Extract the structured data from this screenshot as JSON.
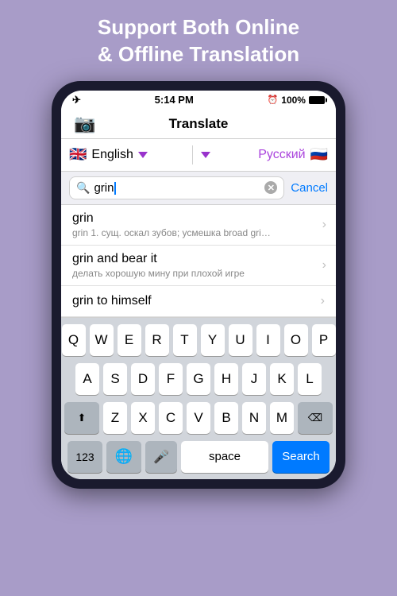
{
  "banner": {
    "line1": "Support Both Online",
    "line2": "& Offline Translation"
  },
  "status_bar": {
    "airplane": "✈",
    "time": "5:14 PM",
    "alarm": "⏰",
    "battery_pct": "100%"
  },
  "nav": {
    "title": "Translate"
  },
  "languages": {
    "left": {
      "flag": "🇬🇧",
      "name": "English"
    },
    "right": {
      "flag": "🇷🇺",
      "name": "Русский"
    }
  },
  "search": {
    "query": "grin",
    "cancel_label": "Cancel"
  },
  "results": [
    {
      "word": "grin",
      "definition": "grin 1. сущ. оскал зубов; усмешка broad gri…",
      "has_def": true
    },
    {
      "word": "grin and bear it",
      "definition": "делать хорошую мину при плохой игре",
      "has_def": true
    },
    {
      "word": "grin to himself",
      "definition": "",
      "has_def": false
    }
  ],
  "keyboard": {
    "row1": [
      "Q",
      "W",
      "E",
      "R",
      "T",
      "Y",
      "U",
      "I",
      "O",
      "P"
    ],
    "row2": [
      "A",
      "S",
      "D",
      "F",
      "G",
      "H",
      "J",
      "K",
      "L"
    ],
    "row3": [
      "Z",
      "X",
      "C",
      "V",
      "B",
      "N",
      "M"
    ],
    "num_label": "123",
    "space_label": "space",
    "search_label": "Search"
  }
}
